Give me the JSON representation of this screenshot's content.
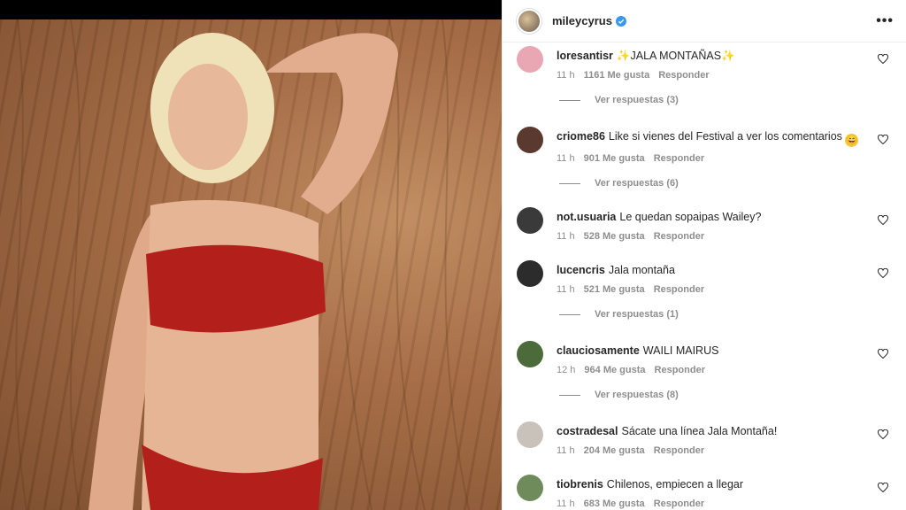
{
  "post": {
    "author": "mileycyrus",
    "more_label": "•••"
  },
  "comments": [
    {
      "user": "loresantisr",
      "text": "✨JALA MONTAÑAS✨",
      "time": "11 h",
      "likes": "1161 Me gusta",
      "reply": "Responder",
      "view_replies": "Ver respuestas (3)",
      "avatar_color": "#e9a6b3"
    },
    {
      "user": "criome86",
      "text": "Like si vienes del Festival a ver los comentarios",
      "emoji": "😄",
      "time": "11 h",
      "likes": "901 Me gusta",
      "reply": "Responder",
      "view_replies": "Ver respuestas (6)",
      "avatar_color": "#5a3a2e"
    },
    {
      "user": "not.usuaria",
      "text": "Le quedan sopaipas Wailey?",
      "time": "11 h",
      "likes": "528 Me gusta",
      "reply": "Responder",
      "view_replies": "",
      "avatar_color": "#3a3a3a"
    },
    {
      "user": "lucencris",
      "text": "Jala montaña",
      "time": "11 h",
      "likes": "521 Me gusta",
      "reply": "Responder",
      "view_replies": "Ver respuestas (1)",
      "avatar_color": "#2c2c2c"
    },
    {
      "user": "clauciosamente",
      "text": "WAILI MAIRUS",
      "time": "12 h",
      "likes": "964 Me gusta",
      "reply": "Responder",
      "view_replies": "Ver respuestas (8)",
      "avatar_color": "#4d6b3a"
    },
    {
      "user": "costradesal",
      "text": "Sácate una línea Jala Montaña!",
      "time": "11 h",
      "likes": "204 Me gusta",
      "reply": "Responder",
      "view_replies": "",
      "avatar_color": "#c9c2bb"
    },
    {
      "user": "tiobrenis",
      "text": "Chilenos, empiecen a llegar",
      "time": "11 h",
      "likes": "683 Me gusta",
      "reply": "Responder",
      "view_replies": "",
      "avatar_color": "#6f8a5b"
    }
  ]
}
